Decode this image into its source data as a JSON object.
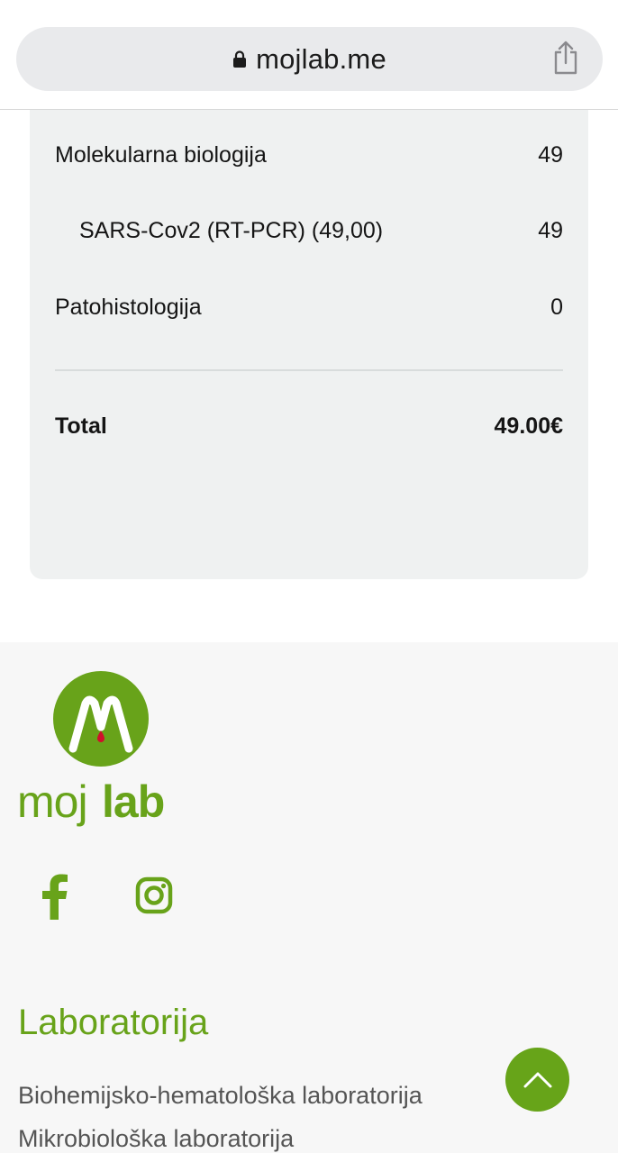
{
  "browser": {
    "url": "mojlab.me",
    "icons": [
      "lock-icon",
      "share-icon"
    ]
  },
  "summary": {
    "rows": [
      {
        "label": "Molekularna biologija",
        "value": "49"
      },
      {
        "label": "SARS-Cov2 (RT-PCR) (49,00)",
        "value": "49"
      },
      {
        "label": "Patohistologija",
        "value": "0"
      }
    ],
    "total_label": "Total",
    "total_value": "49.00€"
  },
  "footer": {
    "brand": {
      "prefix": "moj",
      "suffix": "lab"
    },
    "social_icons": [
      "facebook-icon",
      "instagram-icon"
    ],
    "section_title": "Laboratorija",
    "links": [
      "Biohemijsko-hematološka laboratorija",
      "Mikrobiološka laboratorija"
    ]
  },
  "colors": {
    "brand_green": "#68a31a",
    "card_bg": "#eff1f1",
    "footer_bg": "#f7f7f7"
  }
}
